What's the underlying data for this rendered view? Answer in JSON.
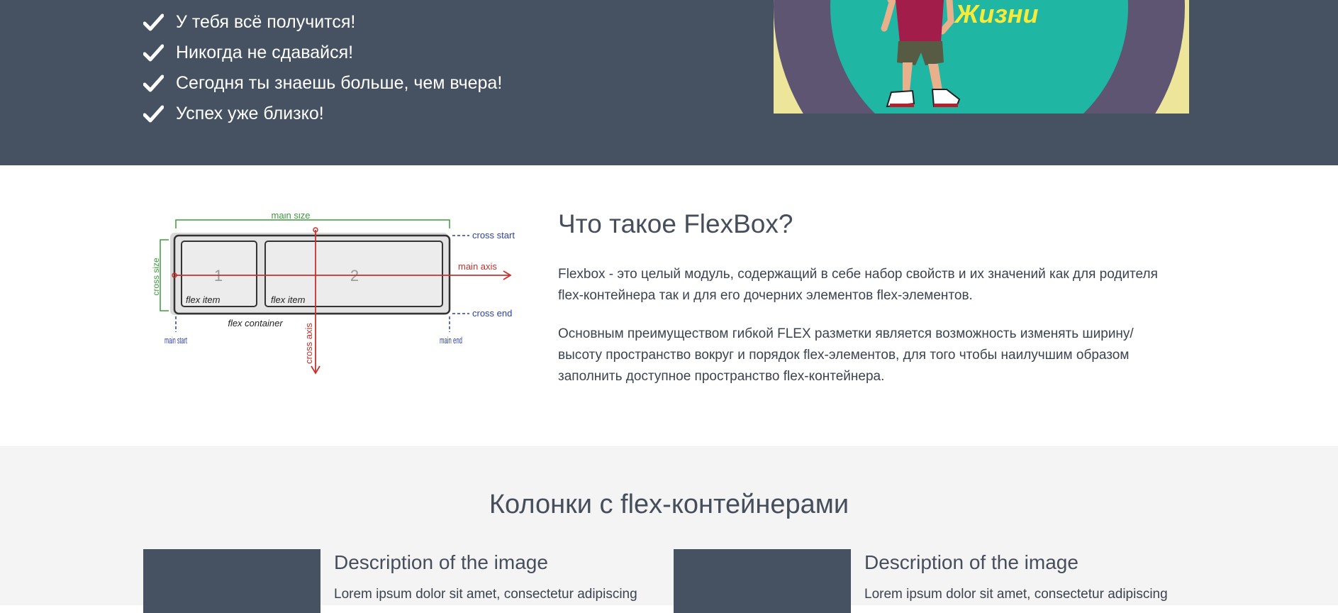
{
  "hero": {
    "checklist": [
      "У тебя всё получится!",
      "Никогда не сдавайся!",
      "Сегодня ты знаешь больше, чем вчера!",
      "Успех уже близко!"
    ],
    "image_caption": "Жизни",
    "colors": {
      "background": "#465162",
      "ring_yellow": "#ece59a",
      "ring_purple": "#5e5572",
      "ring_teal": "#1fb6a4"
    }
  },
  "diagram": {
    "main_size": "main size",
    "cross_start": "cross start",
    "cross_end": "cross end",
    "cross_size": "cross size",
    "main_axis": "main axis",
    "cross_axis": "cross axis",
    "item1_number": "1",
    "item2_number": "2",
    "flex_item": "flex item",
    "flex_container": "flex container",
    "main_start": "main start",
    "main_end": "main end"
  },
  "flexbox": {
    "title": "Что такое FlexBox?",
    "paragraph1": "Flexbox - это целый модуль, содержащий в себе набор свойств и их значений как для родителя flex-контейнера так и для его дочерних элементов flex-элементов.",
    "paragraph2": "Основным преимуществом гибкой FLEX разметки является возможность изменять ширину/ высоту пространство вокруг и порядок flex-элементов, для того чтобы наилучшим образом заполнить доступное пространство flex-контейнера."
  },
  "columns": {
    "title": "Колонки с flex-контейнерами",
    "cards": [
      {
        "title": "Description of the image",
        "text": "Lorem ipsum dolor sit amet, consectetur adipiscing"
      },
      {
        "title": "Description of the image",
        "text": "Lorem ipsum dolor sit amet, consectetur adipiscing"
      }
    ]
  }
}
